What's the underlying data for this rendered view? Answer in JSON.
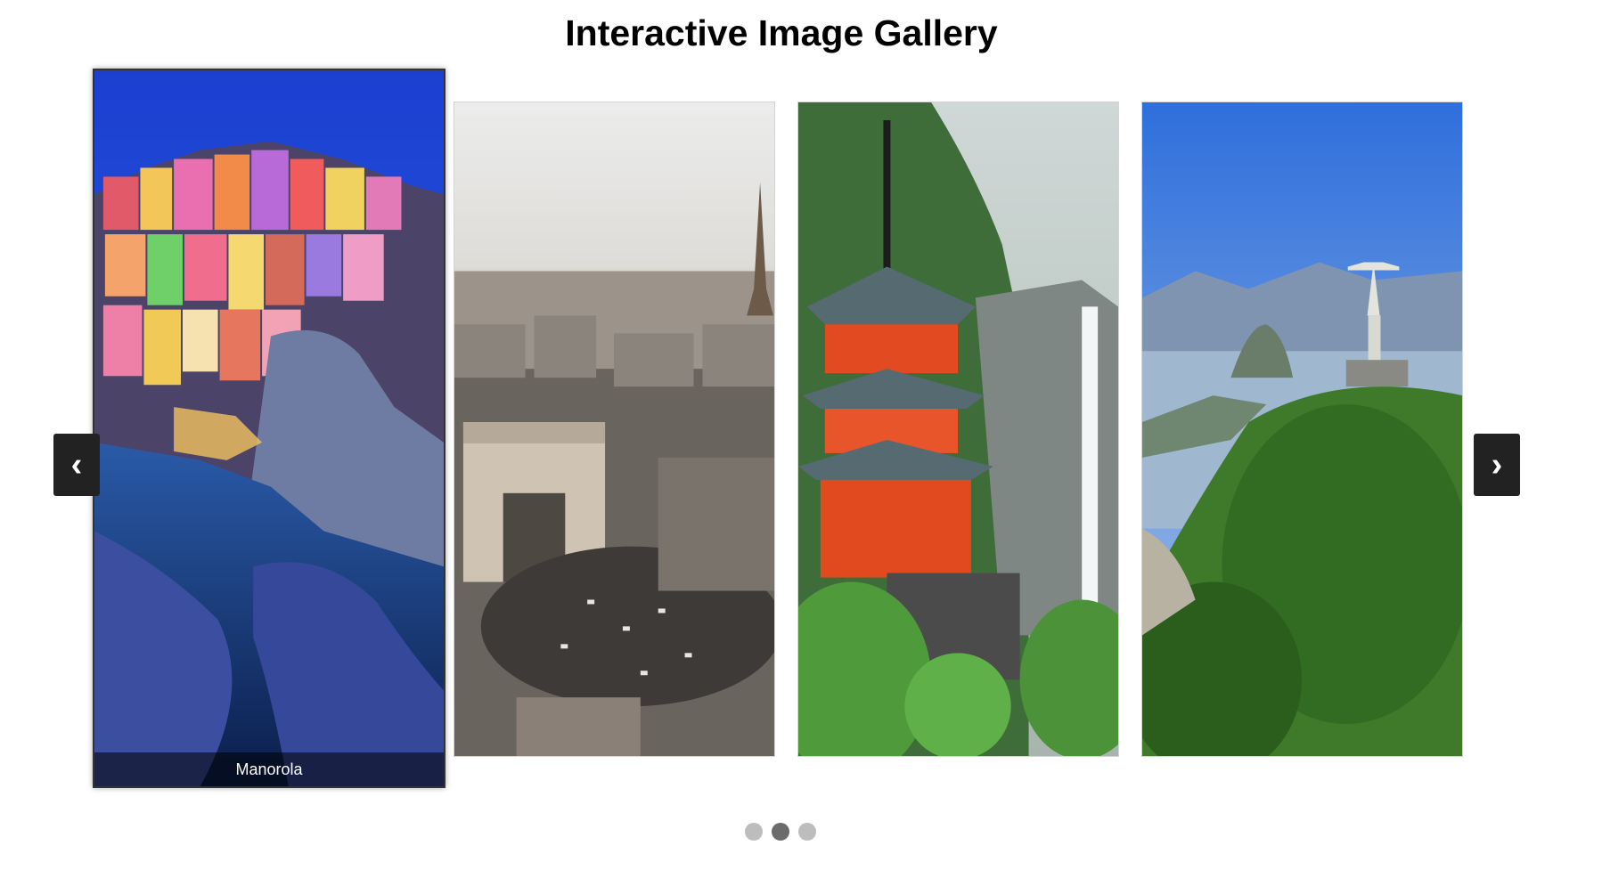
{
  "page": {
    "title": "Interactive Image Gallery"
  },
  "gallery": {
    "prev_label": "‹",
    "next_label": "›",
    "slides": [
      {
        "caption": "Manorola",
        "active": true
      },
      {
        "caption": "",
        "active": false
      },
      {
        "caption": "",
        "active": false
      },
      {
        "caption": "",
        "active": false
      }
    ],
    "dots": [
      {
        "active": false
      },
      {
        "active": true
      },
      {
        "active": false
      }
    ]
  },
  "colors": {
    "nav_bg": "#222222",
    "dot_active": "#6b6b6b",
    "dot_inactive": "#bdbdbd",
    "caption_bg": "rgba(0,0,0,0.55)"
  }
}
